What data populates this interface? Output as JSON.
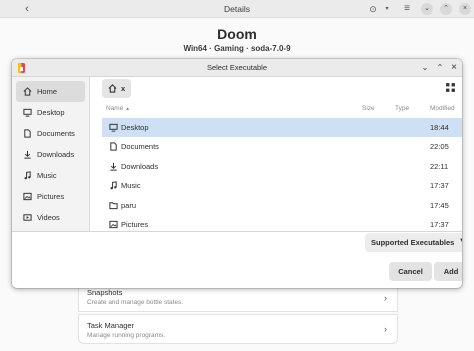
{
  "background": {
    "header_title": "Details",
    "app_name": "Doom",
    "app_meta": "Win64 · Gaming · soda-7.0-9",
    "rows": [
      {
        "title": "Snapshots",
        "subtitle": "Create and manage bottle states."
      },
      {
        "title": "Task Manager",
        "subtitle": "Manage running programs."
      }
    ],
    "icons": {
      "back": "chevron-left-icon",
      "sync": "sync-icon",
      "menu": "menu-icon",
      "chevron": "chevron-right-icon"
    }
  },
  "dialog": {
    "title": "Select Executable",
    "controls": {
      "minimize": "chevron-down-icon",
      "maximize": "chevron-up-icon",
      "close": "close-icon"
    },
    "sidebar": [
      {
        "label": "Home",
        "icon": "home-icon",
        "active": true
      },
      {
        "label": "Desktop",
        "icon": "desktop-icon"
      },
      {
        "label": "Documents",
        "icon": "documents-icon"
      },
      {
        "label": "Downloads",
        "icon": "downloads-icon"
      },
      {
        "label": "Music",
        "icon": "music-icon"
      },
      {
        "label": "Pictures",
        "icon": "pictures-icon"
      },
      {
        "label": "Videos",
        "icon": "videos-icon"
      }
    ],
    "path": {
      "current": "x"
    },
    "columns": {
      "name": "Name",
      "sort_indicator": "▲",
      "size": "Size",
      "type": "Type",
      "modified": "Modified"
    },
    "files": [
      {
        "name": "Desktop",
        "modified": "18:44",
        "icon": "desktop-icon",
        "selected": true
      },
      {
        "name": "Documents",
        "modified": "22:05",
        "icon": "documents-icon"
      },
      {
        "name": "Downloads",
        "modified": "22:11",
        "icon": "downloads-icon"
      },
      {
        "name": "Music",
        "modified": "17:37",
        "icon": "music-icon"
      },
      {
        "name": "paru",
        "modified": "17:45",
        "icon": "folder-icon"
      },
      {
        "name": "Pictures",
        "modified": "17:37",
        "icon": "pictures-icon"
      }
    ],
    "filter": {
      "label": "Supported Executables"
    },
    "buttons": {
      "cancel": "Cancel",
      "add": "Add"
    }
  },
  "colors": {
    "selection": "#cfe0f4",
    "sidebar_active": "#dcdcdc"
  }
}
